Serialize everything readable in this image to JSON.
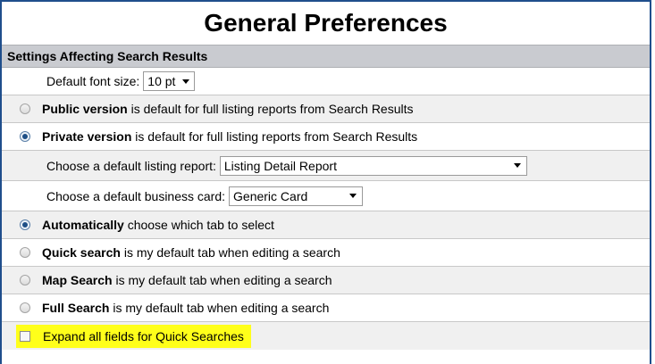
{
  "title": "General Preferences",
  "section_header": "Settings Affecting Search Results",
  "font_size": {
    "label": "Default font size:",
    "value": "10 pt"
  },
  "listing_version": {
    "public": {
      "bold": "Public version",
      "rest": " is default for full listing reports from Search Results",
      "checked": false
    },
    "private": {
      "bold": "Private version",
      "rest": " is default for full listing reports from Search Results",
      "checked": true
    }
  },
  "listing_report": {
    "label": "Choose a default listing report:",
    "value": "Listing Detail Report"
  },
  "business_card": {
    "label": "Choose a default business card:",
    "value": "Generic Card"
  },
  "tab_options": [
    {
      "bold": "Automatically",
      "rest": " choose which tab to select",
      "checked": true
    },
    {
      "bold": "Quick search",
      "rest": " is my default tab when editing a search",
      "checked": false
    },
    {
      "bold": "Map Search",
      "rest": " is my default tab when editing a search",
      "checked": false
    },
    {
      "bold": "Full Search",
      "rest": " is my default tab when editing a search",
      "checked": false
    }
  ],
  "expand_fields": {
    "label": "Expand all fields for Quick Searches",
    "checked": false,
    "highlight_color": "#ffff1a"
  },
  "colors": {
    "border": "#1f4e8c",
    "section_header_bg": "#c9cbd0",
    "alt_row_bg": "#f0f0f0",
    "radio_selected": "#1e4f86"
  }
}
